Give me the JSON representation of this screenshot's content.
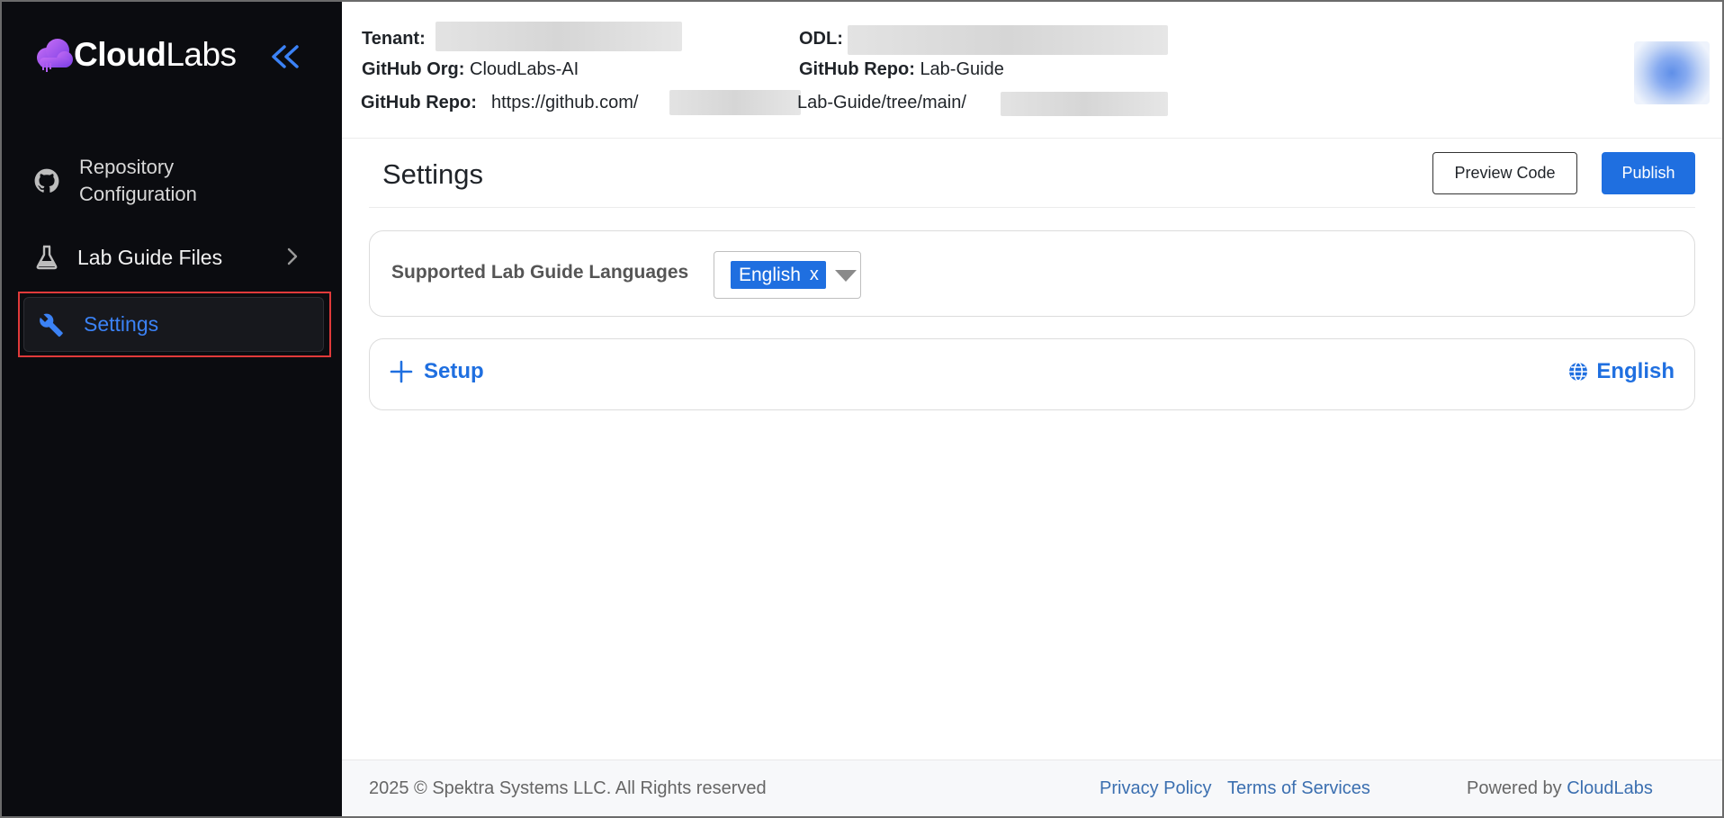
{
  "sidebar": {
    "logo_text_bold": "Cloud",
    "logo_text_regular": "Labs",
    "items": [
      {
        "label_line1": "Repository",
        "label_line2": "Configuration",
        "icon": "github-icon"
      },
      {
        "label": "Lab Guide Files",
        "icon": "flask-icon"
      },
      {
        "label": "Settings",
        "icon": "wrench-icon",
        "active": true
      }
    ]
  },
  "header": {
    "tenant_key": "Tenant:",
    "odl_key": "ODL:",
    "org_key": "GitHub Org:",
    "org_value": "CloudLabs-AI",
    "repo_key": "GitHub Repo:",
    "repo_value": "Lab-Guide",
    "repo_url_key": "GitHub Repo:",
    "repo_url_prefix": "https://github.com/",
    "repo_url_middle": "Lab-Guide/tree/main/"
  },
  "main": {
    "title": "Settings",
    "preview_label": "Preview Code",
    "publish_label": "Publish",
    "languages_label": "Supported Lab Guide Languages",
    "selected_language": "English",
    "chip_remove": "x",
    "setup_label": "Setup",
    "language_label": "English"
  },
  "footer": {
    "copyright": "2025 © Spektra Systems LLC. All Rights reserved",
    "privacy": "Privacy Policy",
    "terms": "Terms of Services",
    "powered_by": "Powered by",
    "brand": "CloudLabs"
  },
  "colors": {
    "accent": "#1f6fe0",
    "sidebar_bg": "#0b0c10",
    "highlight_border": "#e03a3a"
  }
}
